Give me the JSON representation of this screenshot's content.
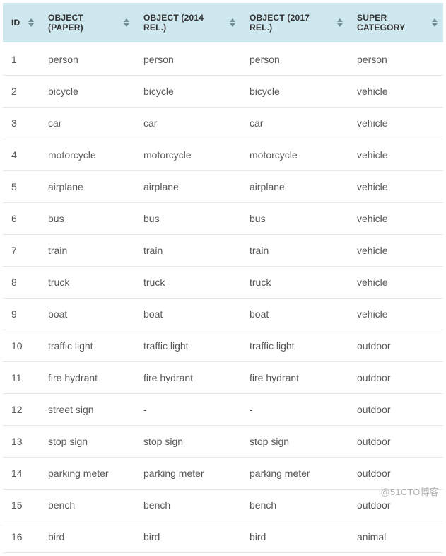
{
  "table": {
    "columns": [
      {
        "label": "ID"
      },
      {
        "label": "OBJECT (PAPER)"
      },
      {
        "label": "OBJECT (2014 REL.)"
      },
      {
        "label": "OBJECT (2017 REL.)"
      },
      {
        "label": "SUPER CATEGORY"
      }
    ],
    "rows": [
      {
        "id": "1",
        "paper": "person",
        "r2014": "person",
        "r2017": "person",
        "super": "person"
      },
      {
        "id": "2",
        "paper": "bicycle",
        "r2014": "bicycle",
        "r2017": "bicycle",
        "super": "vehicle"
      },
      {
        "id": "3",
        "paper": "car",
        "r2014": "car",
        "r2017": "car",
        "super": "vehicle"
      },
      {
        "id": "4",
        "paper": "motorcycle",
        "r2014": "motorcycle",
        "r2017": "motorcycle",
        "super": "vehicle"
      },
      {
        "id": "5",
        "paper": "airplane",
        "r2014": "airplane",
        "r2017": "airplane",
        "super": "vehicle"
      },
      {
        "id": "6",
        "paper": "bus",
        "r2014": "bus",
        "r2017": "bus",
        "super": "vehicle"
      },
      {
        "id": "7",
        "paper": "train",
        "r2014": "train",
        "r2017": "train",
        "super": "vehicle"
      },
      {
        "id": "8",
        "paper": "truck",
        "r2014": "truck",
        "r2017": "truck",
        "super": "vehicle"
      },
      {
        "id": "9",
        "paper": "boat",
        "r2014": "boat",
        "r2017": "boat",
        "super": "vehicle"
      },
      {
        "id": "10",
        "paper": "traffic light",
        "r2014": "traffic light",
        "r2017": "traffic light",
        "super": "outdoor"
      },
      {
        "id": "11",
        "paper": "fire hydrant",
        "r2014": "fire hydrant",
        "r2017": "fire hydrant",
        "super": "outdoor"
      },
      {
        "id": "12",
        "paper": "street sign",
        "r2014": "-",
        "r2017": "-",
        "super": "outdoor"
      },
      {
        "id": "13",
        "paper": "stop sign",
        "r2014": "stop sign",
        "r2017": "stop sign",
        "super": "outdoor"
      },
      {
        "id": "14",
        "paper": "parking meter",
        "r2014": "parking meter",
        "r2017": "parking meter",
        "super": "outdoor"
      },
      {
        "id": "15",
        "paper": "bench",
        "r2014": "bench",
        "r2017": "bench",
        "super": "outdoor"
      },
      {
        "id": "16",
        "paper": "bird",
        "r2014": "bird",
        "r2017": "bird",
        "super": "animal"
      }
    ]
  },
  "watermark": "@51CTO博客"
}
